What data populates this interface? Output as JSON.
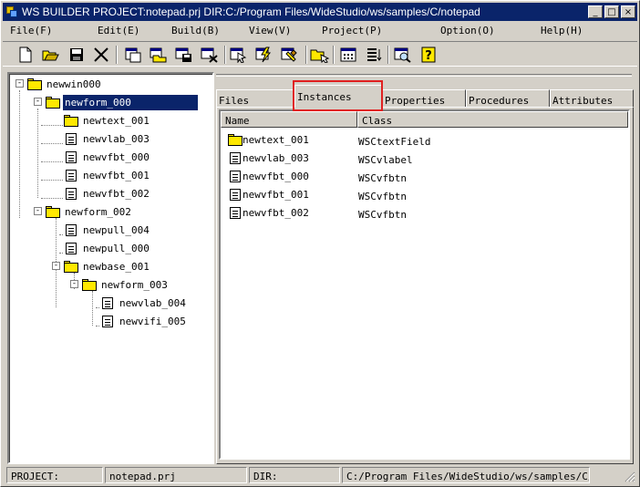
{
  "window": {
    "title": "WS BUILDER PROJECT:notepad.prj DIR:C:/Program Files/WideStudio/ws/samples/C/notepad",
    "buttons": {
      "minimize": "_",
      "maximize": "□",
      "close": "×"
    }
  },
  "menu": [
    "File(F)",
    "Edit(E)",
    "Build(B)",
    "View(V)",
    "Project(P)",
    "Option(O)",
    "Help(H)"
  ],
  "toolbar": [
    "new-file-icon",
    "open-folder-icon",
    "save-disk-icon",
    "cut-icon",
    "new-window-icon",
    "open-window-icon",
    "save-window-icon",
    "close-window-icon",
    "select-icon",
    "run-icon",
    "build-icon",
    "open-instance-icon",
    "grid-icon",
    "list-icon",
    "preview-icon",
    "help-icon"
  ],
  "tree": [
    {
      "label": "newwin000",
      "type": "folder",
      "depth": 0,
      "expander": "-"
    },
    {
      "label": "newform_000",
      "type": "folder",
      "depth": 1,
      "expander": "-",
      "selected": true
    },
    {
      "label": "newtext_001",
      "type": "folder",
      "depth": 2
    },
    {
      "label": "newvlab_003",
      "type": "doc",
      "depth": 2
    },
    {
      "label": "newvfbt_000",
      "type": "doc",
      "depth": 2
    },
    {
      "label": "newvfbt_001",
      "type": "doc",
      "depth": 2
    },
    {
      "label": "newvfbt_002",
      "type": "doc",
      "depth": 2
    },
    {
      "label": "newform_002",
      "type": "folder",
      "depth": 1,
      "expander": "-"
    },
    {
      "label": "newpull_004",
      "type": "doc",
      "depth": 2
    },
    {
      "label": "newpull_000",
      "type": "doc",
      "depth": 2
    },
    {
      "label": "newbase_001",
      "type": "folder",
      "depth": 2,
      "expander": "-"
    },
    {
      "label": "newform_003",
      "type": "folder",
      "depth": 3,
      "expander": "-"
    },
    {
      "label": "newvlab_004",
      "type": "doc",
      "depth": 4
    },
    {
      "label": "newvifi_005",
      "type": "doc",
      "depth": 4
    }
  ],
  "tabs": [
    "Files",
    "Instances",
    "Properties",
    "Procedures",
    "Attributes"
  ],
  "active_tab": "Instances",
  "list": {
    "headers": {
      "name": "Name",
      "class": "Class"
    },
    "rows": [
      {
        "name": "newtext_001",
        "class": "WSCtextField",
        "type": "folder"
      },
      {
        "name": "newvlab_003",
        "class": "WSCvlabel",
        "type": "doc"
      },
      {
        "name": "newvfbt_000",
        "class": "WSCvfbtn",
        "type": "doc"
      },
      {
        "name": "newvfbt_001",
        "class": "WSCvfbtn",
        "type": "doc"
      },
      {
        "name": "newvfbt_002",
        "class": "WSCvfbtn",
        "type": "doc"
      }
    ]
  },
  "status": {
    "project_label": "PROJECT:",
    "project_value": "notepad.prj",
    "dir_label": "DIR:",
    "dir_value": "C:/Program Files/WideStudio/ws/samples/C/note"
  }
}
